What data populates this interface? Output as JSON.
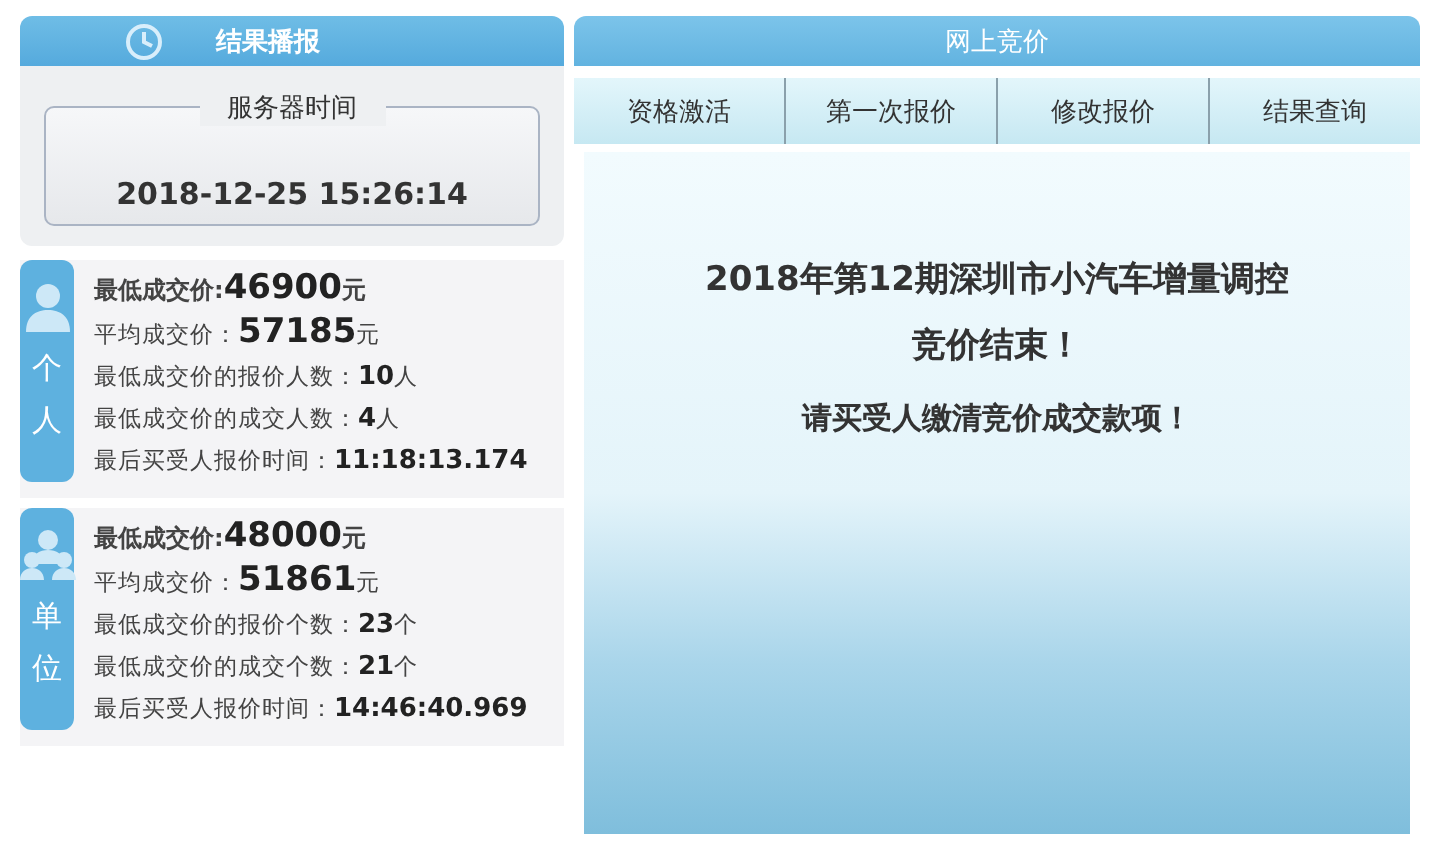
{
  "results_panel": {
    "title": "结果播报",
    "server_time": {
      "label": "服务器时间",
      "value": "2018-12-25 15:26:14"
    },
    "groups": [
      {
        "kind": "person",
        "side_label": "个人",
        "rows": [
          {
            "label": "最低成交价:",
            "value": "46900",
            "unit": "元"
          },
          {
            "label": "平均成交价：",
            "value": "57185",
            "unit": "元"
          },
          {
            "label": "最低成交价的报价人数：",
            "value": "10",
            "unit": "人"
          },
          {
            "label": "最低成交价的成交人数：",
            "value": "4",
            "unit": "人"
          },
          {
            "label": "最后买受人报价时间：",
            "value": "11:18:13.174",
            "unit": ""
          }
        ]
      },
      {
        "kind": "organization",
        "side_label": "单位",
        "rows": [
          {
            "label": "最低成交价:",
            "value": "48000",
            "unit": "元"
          },
          {
            "label": "平均成交价：",
            "value": "51861",
            "unit": "元"
          },
          {
            "label": "最低成交价的报价个数：",
            "value": "23",
            "unit": "个"
          },
          {
            "label": "最低成交价的成交个数：",
            "value": "21",
            "unit": "个"
          },
          {
            "label": "最后买受人报价时间：",
            "value": "14:46:40.969",
            "unit": ""
          }
        ]
      }
    ]
  },
  "bidding_panel": {
    "title": "网上竞价",
    "tabs": [
      "资格激活",
      "第一次报价",
      "修改报价",
      "结果查询"
    ],
    "message": [
      "2018年第12期深圳市小汽车增量调控",
      "竞价结束！",
      "请买受人缴清竞价成交款项！"
    ]
  }
}
